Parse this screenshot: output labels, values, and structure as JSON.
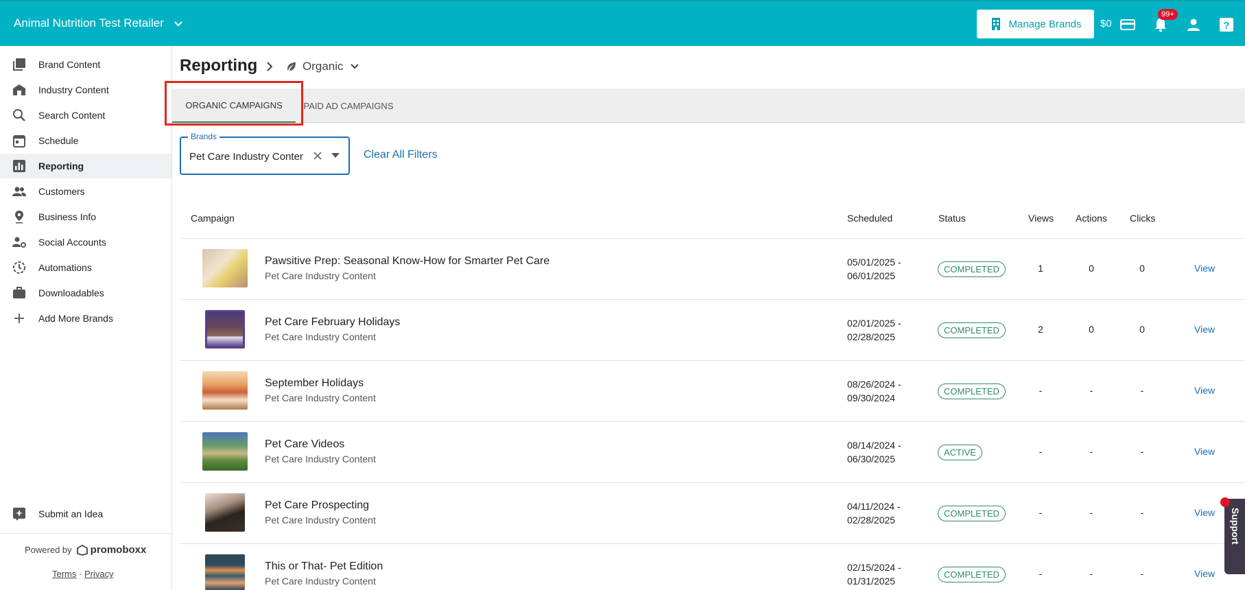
{
  "header": {
    "retailer_name": "Animal Nutrition Test Retailer",
    "manage_brands_label": "Manage Brands",
    "balance": "$0",
    "notification_badge": "99+",
    "accent_color": "#00b2c3"
  },
  "sidebar": {
    "items": [
      {
        "label": "Brand Content",
        "icon": "brand-content-icon"
      },
      {
        "label": "Industry Content",
        "icon": "industry-content-icon"
      },
      {
        "label": "Search Content",
        "icon": "search-icon"
      },
      {
        "label": "Schedule",
        "icon": "calendar-icon"
      },
      {
        "label": "Reporting",
        "icon": "bar-chart-icon"
      },
      {
        "label": "Customers",
        "icon": "people-icon"
      },
      {
        "label": "Business Info",
        "icon": "location-pin-icon"
      },
      {
        "label": "Social Accounts",
        "icon": "person-gear-icon"
      },
      {
        "label": "Automations",
        "icon": "automation-icon"
      },
      {
        "label": "Downloadables",
        "icon": "briefcase-icon"
      },
      {
        "label": "Add More Brands",
        "icon": "plus-icon"
      }
    ],
    "submit_idea": "Submit an Idea",
    "powered_by": "Powered by",
    "logo_text": "promoboxx",
    "terms": "Terms",
    "separator": "·",
    "privacy": "Privacy"
  },
  "page": {
    "title": "Reporting",
    "breadcrumb": "Organic",
    "tabs": [
      "ORGANIC CAMPAIGNS",
      "PAID AD CAMPAIGNS"
    ],
    "filter": {
      "label": "Brands",
      "value": "Pet Care Industry Content"
    },
    "clear_filters": "Clear All Filters"
  },
  "table": {
    "headers": {
      "campaign": "Campaign",
      "scheduled": "Scheduled",
      "status": "Status",
      "views": "Views",
      "actions": "Actions",
      "clicks": "Clicks"
    },
    "rows": [
      {
        "title": "Pawsitive Prep: Seasonal Know-How for Smarter Pet Care",
        "subtitle": "Pet Care Industry Content",
        "start": "05/01/2025 -",
        "end": "06/01/2025",
        "status": "COMPLETED",
        "views": "1",
        "actions": "0",
        "clicks": "0",
        "link": "View"
      },
      {
        "title": "Pet Care February Holidays",
        "subtitle": "Pet Care Industry Content",
        "start": "02/01/2025 -",
        "end": "02/28/2025",
        "status": "COMPLETED",
        "views": "2",
        "actions": "0",
        "clicks": "0",
        "link": "View"
      },
      {
        "title": "September Holidays",
        "subtitle": "Pet Care Industry Content",
        "start": "08/26/2024 -",
        "end": "09/30/2024",
        "status": "COMPLETED",
        "views": "-",
        "actions": "-",
        "clicks": "-",
        "link": "View"
      },
      {
        "title": "Pet Care Videos",
        "subtitle": "Pet Care Industry Content",
        "start": "08/14/2024 -",
        "end": "06/30/2025",
        "status": "ACTIVE",
        "views": "-",
        "actions": "-",
        "clicks": "-",
        "link": "View"
      },
      {
        "title": "Pet Care Prospecting",
        "subtitle": "Pet Care Industry Content",
        "start": "04/11/2024 -",
        "end": "02/28/2025",
        "status": "COMPLETED",
        "views": "-",
        "actions": "-",
        "clicks": "-",
        "link": "View"
      },
      {
        "title": "This or That- Pet Edition",
        "subtitle": "Pet Care Industry Content",
        "start": "02/15/2024 -",
        "end": "01/31/2025",
        "status": "COMPLETED",
        "views": "-",
        "actions": "-",
        "clicks": "-",
        "link": "View"
      }
    ]
  },
  "support_label": "Support"
}
